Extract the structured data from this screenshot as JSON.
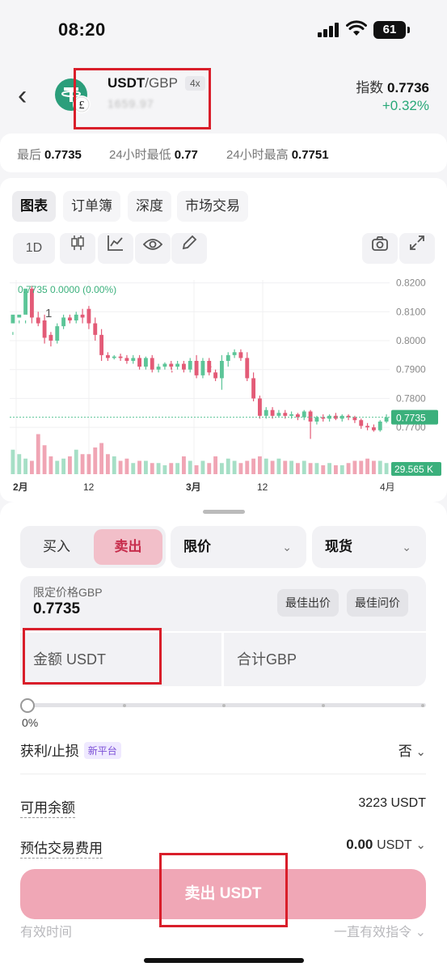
{
  "status": {
    "time": "08:20",
    "battery": "61"
  },
  "header": {
    "pair_base": "USDT",
    "pair_sep": "/",
    "pair_quote": "GBP",
    "leverage": "4x",
    "pair_sub": "1659.97",
    "coin_symbol": "£",
    "index_label": "指数",
    "index_value": "0.7736",
    "change": "+0.32%"
  },
  "stats": {
    "last_label": "最后",
    "last_value": "0.7735",
    "low_label": "24小时最低",
    "low_value": "0.77",
    "high_label": "24小时最高",
    "high_value": "0.7751"
  },
  "chart_tabs": [
    "图表",
    "订单簿",
    "深度",
    "市场交易"
  ],
  "chart_tools": {
    "interval": "1D"
  },
  "chart_data": {
    "type": "candlestick",
    "header_label": "0.7735  0.0000 (0.00%)",
    "marker_label": "1",
    "y_ticks": [
      "0.8200",
      "0.8100",
      "0.8000",
      "0.7900",
      "0.7800",
      "0.7700"
    ],
    "x_ticks": [
      "2月",
      "12",
      "3月",
      "12",
      "4月"
    ],
    "last_price_tag": "0.7735",
    "volume_tag": "29.565 K",
    "ylim": [
      0.765,
      0.821
    ],
    "colors": {
      "up": "#5cc598",
      "down": "#e35b77"
    },
    "candles": [
      [
        0.806,
        0.809,
        0.803,
        0.802
      ],
      [
        0.808,
        0.809,
        0.807,
        0.806
      ],
      [
        0.809,
        0.818,
        0.807,
        0.806
      ],
      [
        0.818,
        0.808,
        0.819,
        0.806
      ],
      [
        0.808,
        0.806,
        0.81,
        0.805
      ],
      [
        0.807,
        0.801,
        0.809,
        0.799
      ],
      [
        0.802,
        0.8,
        0.803,
        0.798
      ],
      [
        0.8,
        0.805,
        0.806,
        0.799
      ],
      [
        0.805,
        0.808,
        0.809,
        0.804
      ],
      [
        0.808,
        0.807,
        0.809,
        0.806
      ],
      [
        0.807,
        0.809,
        0.81,
        0.806
      ],
      [
        0.809,
        0.808,
        0.811,
        0.806
      ],
      [
        0.811,
        0.806,
        0.812,
        0.804
      ],
      [
        0.806,
        0.802,
        0.808,
        0.8
      ],
      [
        0.802,
        0.795,
        0.804,
        0.793
      ],
      [
        0.795,
        0.794,
        0.796,
        0.793
      ],
      [
        0.794,
        0.7945,
        0.795,
        0.7935
      ],
      [
        0.7945,
        0.794,
        0.7955,
        0.793
      ],
      [
        0.794,
        0.793,
        0.795,
        0.792
      ],
      [
        0.793,
        0.794,
        0.795,
        0.792
      ],
      [
        0.794,
        0.791,
        0.795,
        0.79
      ],
      [
        0.791,
        0.794,
        0.7945,
        0.79
      ],
      [
        0.794,
        0.79,
        0.795,
        0.789
      ],
      [
        0.79,
        0.791,
        0.792,
        0.789
      ],
      [
        0.791,
        0.792,
        0.7925,
        0.79
      ],
      [
        0.792,
        0.791,
        0.793,
        0.79
      ],
      [
        0.791,
        0.792,
        0.793,
        0.79
      ],
      [
        0.792,
        0.79,
        0.793,
        0.789
      ],
      [
        0.79,
        0.793,
        0.794,
        0.789
      ],
      [
        0.793,
        0.788,
        0.795,
        0.787
      ],
      [
        0.788,
        0.793,
        0.794,
        0.787
      ],
      [
        0.793,
        0.789,
        0.794,
        0.788
      ],
      [
        0.789,
        0.787,
        0.79,
        0.786
      ],
      [
        0.787,
        0.793,
        0.795,
        0.783
      ],
      [
        0.793,
        0.795,
        0.796,
        0.791
      ],
      [
        0.795,
        0.796,
        0.797,
        0.794
      ],
      [
        0.796,
        0.794,
        0.797,
        0.793
      ],
      [
        0.794,
        0.787,
        0.796,
        0.786
      ],
      [
        0.787,
        0.78,
        0.789,
        0.779
      ],
      [
        0.78,
        0.774,
        0.781,
        0.773
      ],
      [
        0.774,
        0.776,
        0.777,
        0.773
      ],
      [
        0.776,
        0.774,
        0.777,
        0.773
      ],
      [
        0.774,
        0.775,
        0.776,
        0.7735
      ],
      [
        0.775,
        0.774,
        0.776,
        0.773
      ],
      [
        0.774,
        0.7745,
        0.7755,
        0.773
      ],
      [
        0.7745,
        0.7735,
        0.775,
        0.7725
      ],
      [
        0.7735,
        0.7755,
        0.776,
        0.7725
      ],
      [
        0.7755,
        0.772,
        0.776,
        0.766
      ],
      [
        0.772,
        0.7735,
        0.774,
        0.771
      ],
      [
        0.7735,
        0.773,
        0.7745,
        0.772
      ],
      [
        0.773,
        0.774,
        0.7745,
        0.772
      ],
      [
        0.774,
        0.773,
        0.775,
        0.7725
      ],
      [
        0.773,
        0.774,
        0.7745,
        0.772
      ],
      [
        0.774,
        0.7735,
        0.7745,
        0.7725
      ],
      [
        0.7735,
        0.7725,
        0.774,
        0.7715
      ],
      [
        0.7725,
        0.7705,
        0.773,
        0.7695
      ],
      [
        0.7705,
        0.77,
        0.7715,
        0.769
      ],
      [
        0.77,
        0.769,
        0.771,
        0.7685
      ],
      [
        0.769,
        0.772,
        0.7725,
        0.7685
      ],
      [
        0.772,
        0.7735,
        0.7745,
        0.7715
      ]
    ],
    "volumes": [
      0.55,
      0.45,
      0.35,
      0.3,
      0.9,
      0.65,
      0.4,
      0.3,
      0.35,
      0.4,
      0.55,
      0.45,
      0.45,
      0.6,
      0.7,
      0.45,
      0.4,
      0.3,
      0.35,
      0.25,
      0.3,
      0.3,
      0.25,
      0.25,
      0.2,
      0.25,
      0.25,
      0.4,
      0.3,
      0.2,
      0.3,
      0.25,
      0.4,
      0.25,
      0.35,
      0.3,
      0.25,
      0.3,
      0.35,
      0.4,
      0.35,
      0.3,
      0.35,
      0.3,
      0.3,
      0.25,
      0.3,
      0.25,
      0.25,
      0.2,
      0.25,
      0.2,
      0.2,
      0.25,
      0.3,
      0.3,
      0.35,
      0.3,
      0.3,
      0.25
    ]
  },
  "trade": {
    "buy_label": "买入",
    "sell_label": "卖出",
    "order_type": "限价",
    "account_type": "现货",
    "limit_price_label": "限定价格GBP",
    "limit_price_value": "0.7735",
    "best_bid_label": "最佳出价",
    "best_ask_label": "最佳问价",
    "amount_placeholder": "金额 USDT",
    "total_placeholder": "合计GBP",
    "percent": "0%",
    "tpsl_label": "获利/止损",
    "tpsl_badge": "新平台",
    "tpsl_value": "否",
    "available_label": "可用余额",
    "available_value": "3223 USDT",
    "fee_label": "预估交易费用",
    "fee_value": "0.00",
    "fee_unit": "USDT",
    "submit_label": "卖出 USDT",
    "validity_label": "有效时间",
    "validity_value": "一直有效指令"
  }
}
